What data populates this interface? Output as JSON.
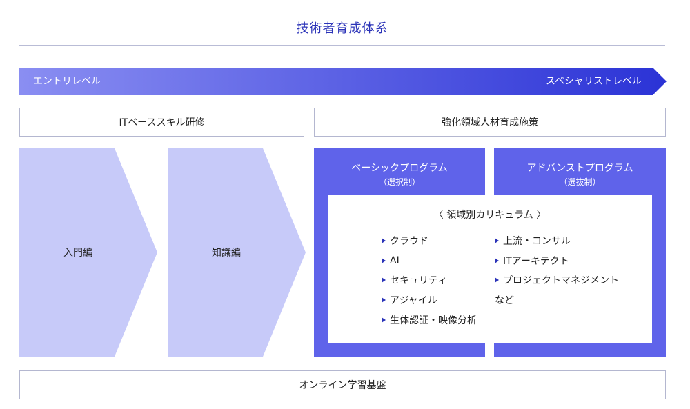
{
  "title": "技術者育成体系",
  "level_bar": {
    "left_label": "エントリレベル",
    "right_label": "スペシャリストレベル",
    "gradient_start": "#8a8ef2",
    "gradient_end": "#2b33d6"
  },
  "it_base": {
    "label": "ITベーススキル研修"
  },
  "strengthen": {
    "label": "強化領域人材育成施策"
  },
  "chevrons": [
    {
      "label": "入門編"
    },
    {
      "label": "知識編"
    }
  ],
  "programs": [
    {
      "title": "ベーシックプログラム",
      "subtitle": "（選択制）"
    },
    {
      "title": "アドバンストプログラム",
      "subtitle": "（選抜制）"
    }
  ],
  "curriculum": {
    "title": "〈 領域別カリキュラム 〉",
    "left_items": [
      "クラウド",
      "AI",
      "セキュリティ",
      "アジャイル",
      "生体認証・映像分析"
    ],
    "right_items": [
      "上流・コンサル",
      "ITアーキテクト",
      "プロジェクトマネジメント"
    ],
    "etc": "など"
  },
  "online": {
    "label": "オンライン学習基盤"
  },
  "colors": {
    "accent": "#2b33b8",
    "program_fill": "#5f63ea",
    "chevron_fill": "#c7caf9",
    "border": "#b4b7d0"
  }
}
